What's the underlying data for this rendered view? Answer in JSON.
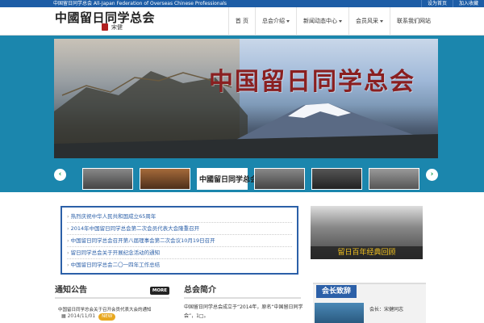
{
  "topbar": {
    "tagline": "中国留日同学总会 All-Japan Federation of Overseas Chinese Professionals",
    "links": [
      "设为首页",
      "加入收藏"
    ]
  },
  "header": {
    "logo_text": "中國留日同学总会",
    "logo_signature": "宋健"
  },
  "nav": {
    "items": [
      {
        "label": "首 页",
        "has_caret": false
      },
      {
        "label": "总会介绍",
        "has_caret": true
      },
      {
        "label": "新闻动态中心",
        "has_caret": true
      },
      {
        "label": "会员风采",
        "has_caret": true
      },
      {
        "label": "联系我们网站",
        "has_caret": false
      }
    ]
  },
  "banner": {
    "title": "中国留日同学总会"
  },
  "strip": {
    "thumb3_text": "中國留日同学总会",
    "prev": "‹",
    "next": "›"
  },
  "news": {
    "items": [
      "热烈庆祝中华人民共和国成立65周年",
      "2014年中国留日同学总会第二次会员代表大会隆重召开",
      "中国留日同学总会召开第八届理事会第二次会议10月19日召开",
      "留日同学总会关于开展纪念活动的通知",
      "中国留日同学总会二〇一四年工作总结"
    ]
  },
  "photo": {
    "caption": "留日百年经典回顾"
  },
  "col1": {
    "title": "通知公告",
    "more": "MORE",
    "item": "中国留日同学总会关于召开会员代表大会的通知",
    "date": "2014/11/01",
    "badge": "NEW"
  },
  "col2": {
    "title": "总会简介",
    "text": "中国留日同学总会成立于“2014年，原名“中国留日同学会”，1□。"
  },
  "side": {
    "title": "会长致辞",
    "name": "会长：宋健同志"
  },
  "colors": {
    "topbar": "#1d5da6",
    "page_bg": "#1b86ad",
    "accent": "#2c60a8",
    "arrow": "#0d9a4a",
    "new_badge": "#e8a820"
  }
}
